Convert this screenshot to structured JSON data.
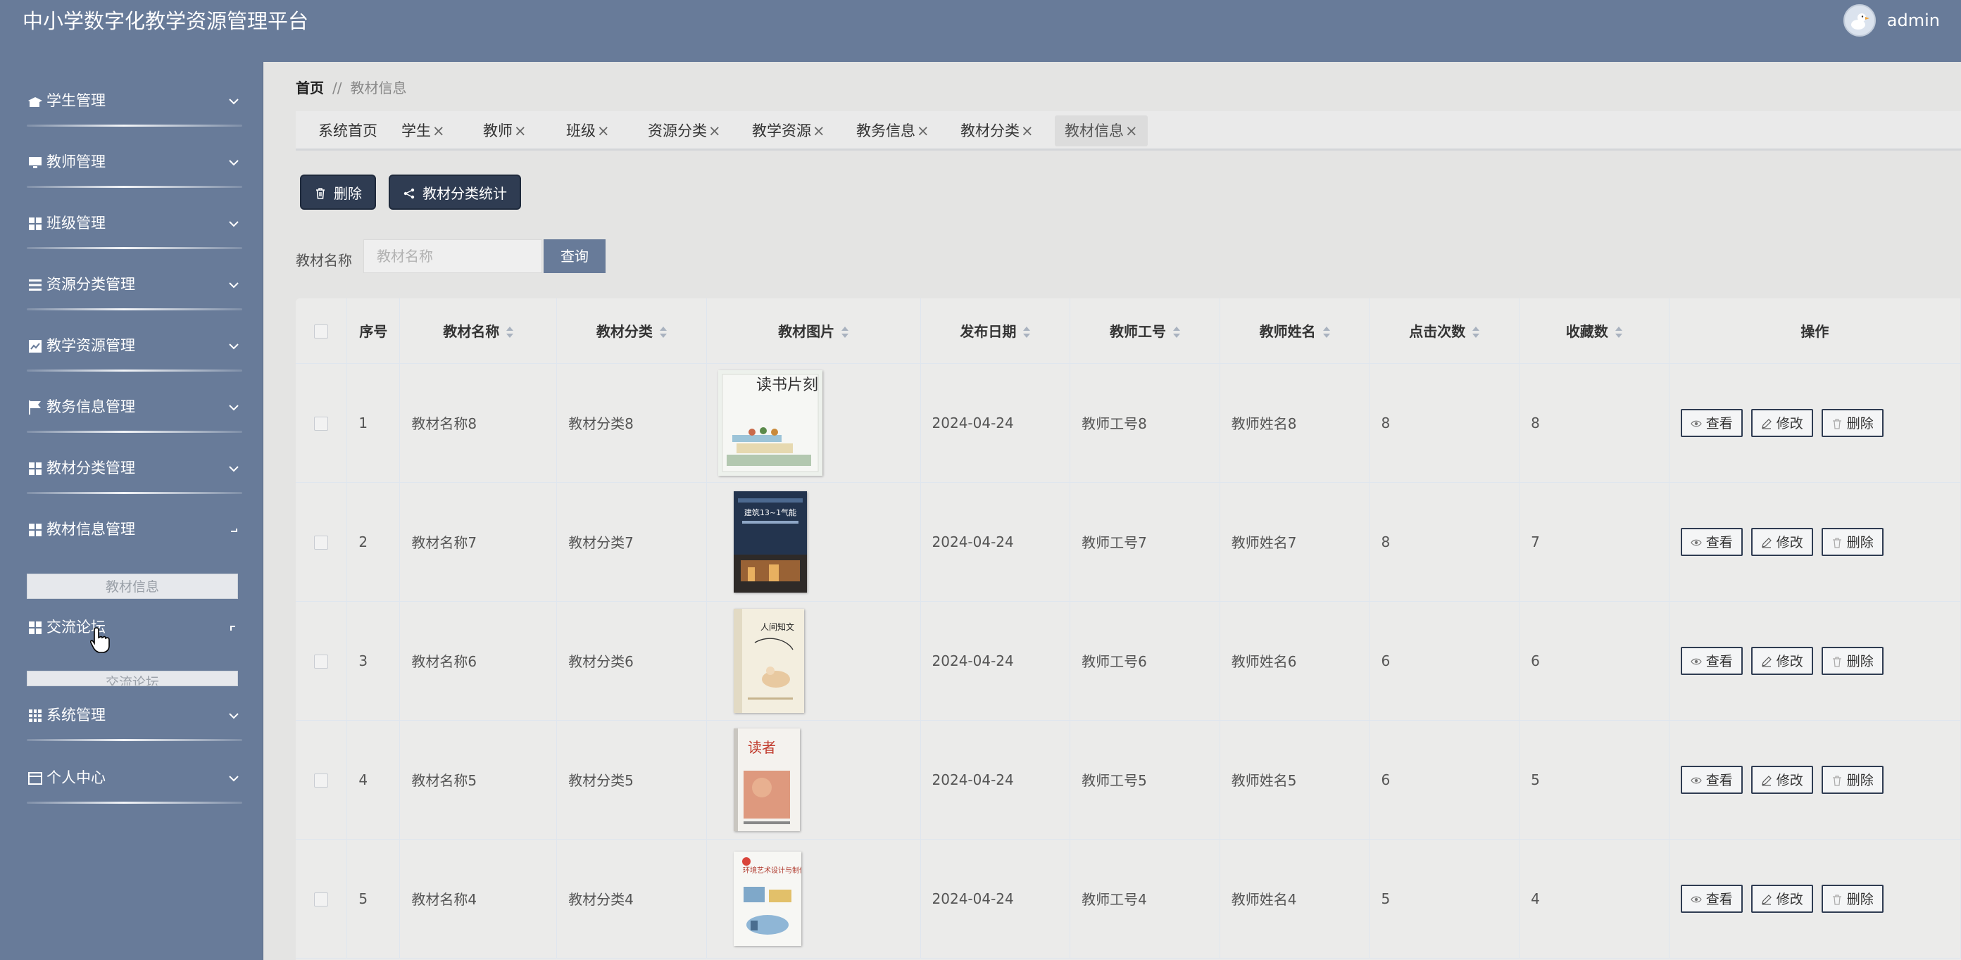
{
  "header": {
    "title": "中小学数字化教学资源管理平台",
    "user": "admin"
  },
  "sidebar": {
    "items": [
      {
        "label": "学生管理",
        "icon": "graduation-icon"
      },
      {
        "label": "教师管理",
        "icon": "monitor-icon"
      },
      {
        "label": "班级管理",
        "icon": "grid-icon"
      },
      {
        "label": "资源分类管理",
        "icon": "list-icon"
      },
      {
        "label": "教学资源管理",
        "icon": "chart-icon"
      },
      {
        "label": "教务信息管理",
        "icon": "flag-icon"
      },
      {
        "label": "教材分类管理",
        "icon": "grid-icon"
      },
      {
        "label": "教材信息管理",
        "icon": "grid-icon"
      },
      {
        "label": "交流论坛",
        "icon": "grid-icon"
      },
      {
        "label": "系统管理",
        "icon": "table-icon"
      },
      {
        "label": "个人中心",
        "icon": "card-icon"
      }
    ],
    "submenu_textbook": "教材信息",
    "submenu_forum": "交流论坛"
  },
  "breadcrumb": {
    "home": "首页",
    "separator": "//",
    "current": "教材信息"
  },
  "tabs": [
    {
      "label": "系统首页",
      "closable": false
    },
    {
      "label": "学生",
      "closable": true
    },
    {
      "label": "教师",
      "closable": true
    },
    {
      "label": "班级",
      "closable": true
    },
    {
      "label": "资源分类",
      "closable": true
    },
    {
      "label": "教学资源",
      "closable": true
    },
    {
      "label": "教务信息",
      "closable": true
    },
    {
      "label": "教材分类",
      "closable": true
    },
    {
      "label": "教材信息",
      "closable": true,
      "active": true
    }
  ],
  "tab_close_symbol": "×",
  "toolbar": {
    "delete": "删除",
    "stats": "教材分类统计"
  },
  "search": {
    "label": "教材名称",
    "placeholder": "教材名称",
    "button": "查询"
  },
  "table": {
    "columns": [
      "序号",
      "教材名称",
      "教材分类",
      "教材图片",
      "发布日期",
      "教师工号",
      "教师姓名",
      "点击次数",
      "收藏数",
      "操作"
    ],
    "actions": {
      "view": "查看",
      "edit": "修改",
      "delete": "删除"
    },
    "rows": [
      {
        "no": "1",
        "name": "教材名称8",
        "category": "教材分类8",
        "date": "2024-04-24",
        "teacher_id": "教师工号8",
        "teacher_name": "教师姓名8",
        "clicks": "8",
        "favorites": "8",
        "cover_text": "读书片刻"
      },
      {
        "no": "2",
        "name": "教材名称7",
        "category": "教材分类7",
        "date": "2024-04-24",
        "teacher_id": "教师工号7",
        "teacher_name": "教师姓名7",
        "clicks": "8",
        "favorites": "7",
        "cover_text": "建筑13~1气能"
      },
      {
        "no": "3",
        "name": "教材名称6",
        "category": "教材分类6",
        "date": "2024-04-24",
        "teacher_id": "教师工号6",
        "teacher_name": "教师姓名6",
        "clicks": "6",
        "favorites": "6",
        "cover_text": "人间知文"
      },
      {
        "no": "4",
        "name": "教材名称5",
        "category": "教材分类5",
        "date": "2024-04-24",
        "teacher_id": "教师工号5",
        "teacher_name": "教师姓名5",
        "clicks": "6",
        "favorites": "5",
        "cover_text": "读者"
      },
      {
        "no": "5",
        "name": "教材名称4",
        "category": "教材分类4",
        "date": "2024-04-24",
        "teacher_id": "教师工号4",
        "teacher_name": "教师姓名4",
        "clicks": "5",
        "favorites": "4",
        "cover_text": "环境艺术设计与制作"
      }
    ]
  },
  "colors": {
    "primary": "#687b99",
    "dark_button": "#2f3c52",
    "background": "#e4e4e3"
  }
}
